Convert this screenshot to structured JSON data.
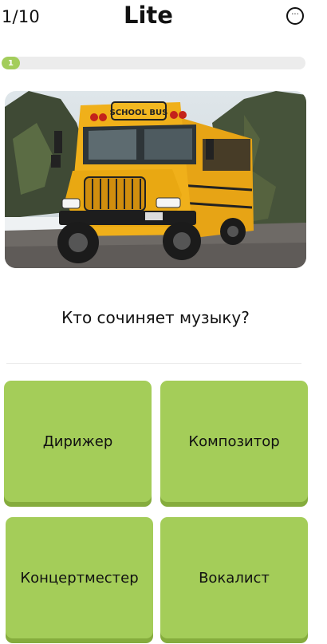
{
  "header": {
    "counter": "1/10",
    "title": "Lite",
    "menu_icon": "more-horizontal-icon",
    "menu_glyph": "···"
  },
  "progress": {
    "current": 1,
    "total": 10,
    "label": "1",
    "fraction": 0.06
  },
  "image": {
    "subject_sign": "SCHOOL BUS"
  },
  "question": {
    "text": "Кто сочиняет музыку?"
  },
  "answers": [
    {
      "label": "Дирижер"
    },
    {
      "label": "Композитор"
    },
    {
      "label": "Концертместер"
    },
    {
      "label": "Вокалист"
    }
  ],
  "colors": {
    "accent": "#a3cd5b",
    "accent_shadow": "#85ac3d",
    "progress_track": "#ececec"
  }
}
